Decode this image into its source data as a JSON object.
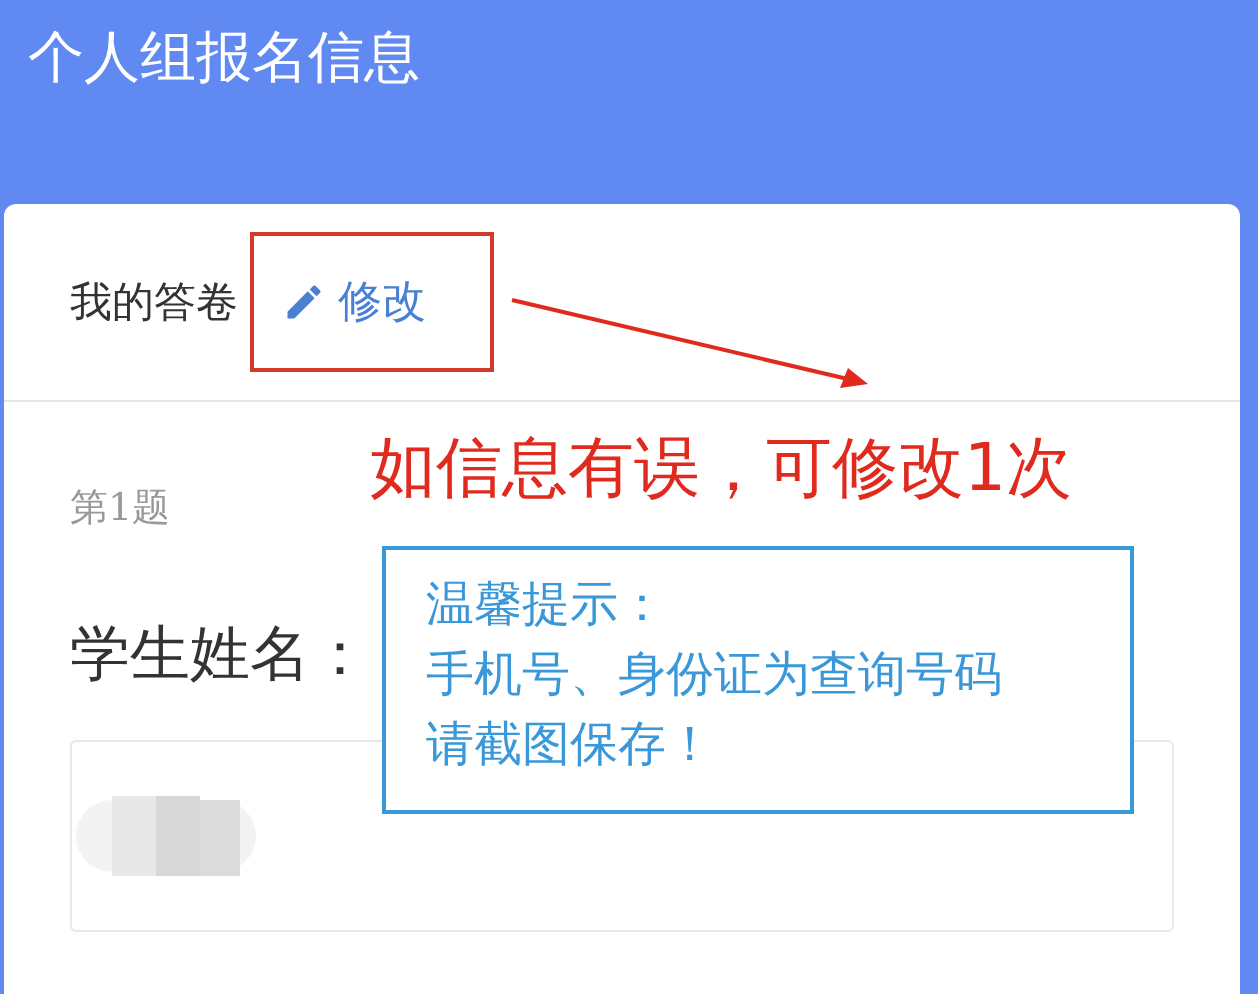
{
  "header": {
    "title": "个人组报名信息"
  },
  "card": {
    "section_label": "我的答卷",
    "edit_link": "修改",
    "questions": [
      {
        "number": "第1题",
        "label": "学生姓名："
      }
    ]
  },
  "annotations": {
    "note": "如信息有误，可修改1次",
    "tip_lines": [
      "温馨提示：",
      "手机号、身份证为查询号码",
      "请截图保存！"
    ]
  }
}
